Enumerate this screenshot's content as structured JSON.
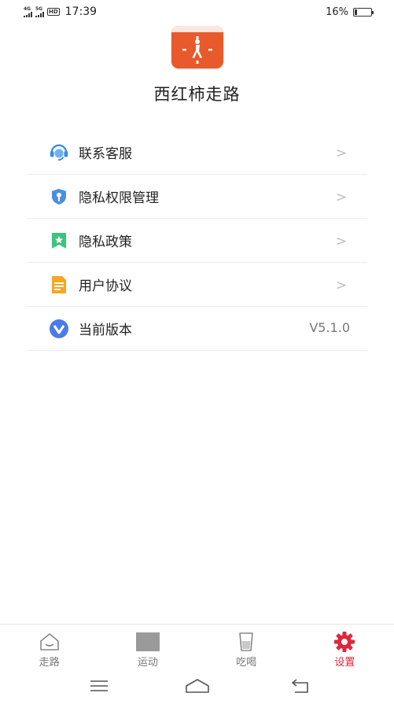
{
  "status_bar": {
    "signal1_label": "4G",
    "signal2_label": "5G",
    "hd_label": "HD",
    "time": "17:39",
    "battery_percent": "16%",
    "battery_level": 0.16
  },
  "app": {
    "name": "西红柿走路",
    "icon": "walking-person-clock-icon",
    "icon_color": "#e85a2c"
  },
  "menu": {
    "items": [
      {
        "label": "联系客服",
        "icon": "headset-icon",
        "icon_color": "#3b8be8"
      },
      {
        "label": "隐私权限管理",
        "icon": "shield-key-icon",
        "icon_color": "#4a90e2"
      },
      {
        "label": "隐私政策",
        "icon": "bookmark-star-icon",
        "icon_color": "#3cc47c"
      },
      {
        "label": "用户协议",
        "icon": "document-icon",
        "icon_color": "#f5a623"
      },
      {
        "label": "当前版本",
        "icon": "v-badge-icon",
        "icon_color": "#4a7be8",
        "value": "V5.1.0"
      }
    ],
    "chevron": ">"
  },
  "tabbar": {
    "tabs": [
      {
        "label": "走路",
        "icon": "house-face-icon",
        "active": false
      },
      {
        "label": "运动",
        "icon": "sport-placeholder-icon",
        "active": false
      },
      {
        "label": "吃喝",
        "icon": "cup-icon",
        "active": false
      },
      {
        "label": "设置",
        "icon": "gear-icon",
        "active": true
      }
    ],
    "active_color": "#e0263a"
  },
  "navbar": {
    "buttons": [
      "menu-icon",
      "home-icon",
      "back-icon"
    ]
  }
}
